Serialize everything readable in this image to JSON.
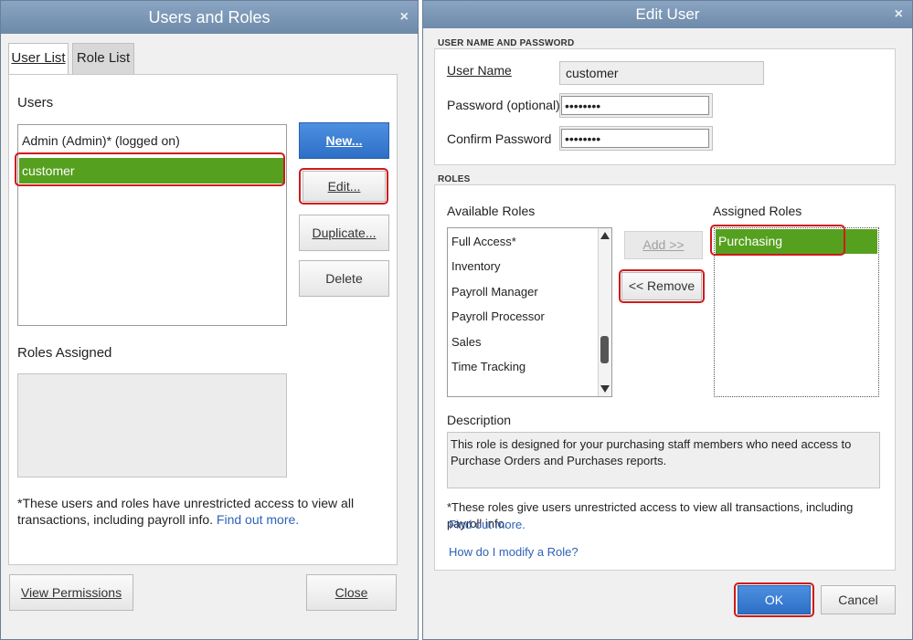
{
  "users_roles": {
    "title": "Users and Roles",
    "close_x": "×",
    "tabs": [
      "User List",
      "Role List"
    ],
    "users_label": "Users",
    "users": [
      "Admin (Admin)* (logged on)",
      "customer"
    ],
    "selected_user_index": 1,
    "buttons": {
      "new": "New...",
      "edit": "Edit...",
      "duplicate": "Duplicate...",
      "delete": "Delete"
    },
    "roles_assigned_label": "Roles Assigned",
    "note": "*These users and roles have unrestricted access to view all transactions, including payroll info.",
    "find_out_more": "Find out more.",
    "view_permissions": "View Permissions",
    "close": "Close"
  },
  "edit_user": {
    "title": "Edit User",
    "close_x": "×",
    "section_user": "USER NAME AND PASSWORD",
    "user_name_label": "User Name",
    "user_name_value": "customer",
    "password_label": "Password (optional)",
    "password_value": "••••••••",
    "confirm_label": "Confirm Password",
    "confirm_value": "••••••••",
    "section_roles": "ROLES",
    "available_roles_label": "Available Roles",
    "available_roles": [
      "Full Access*",
      "Inventory",
      "Payroll Manager",
      "Payroll Processor",
      "Sales",
      "Time Tracking"
    ],
    "assigned_roles_label": "Assigned Roles",
    "assigned_roles": [
      "Purchasing"
    ],
    "add_button": "Add >>",
    "remove_button": "<< Remove",
    "description_label": "Description",
    "description_text": "This role is designed for your purchasing staff members who need access to Purchase Orders and Purchases reports.",
    "note": "*These roles give users unrestricted access to view all transactions, including payroll info.",
    "find_out_more": "Find out more.",
    "modify_role_link": "How do I modify a Role?",
    "ok": "OK",
    "cancel": "Cancel"
  },
  "colors": {
    "selection": "#56a01f",
    "accent": "#2d6fc6",
    "highlight": "#d01a1a"
  }
}
